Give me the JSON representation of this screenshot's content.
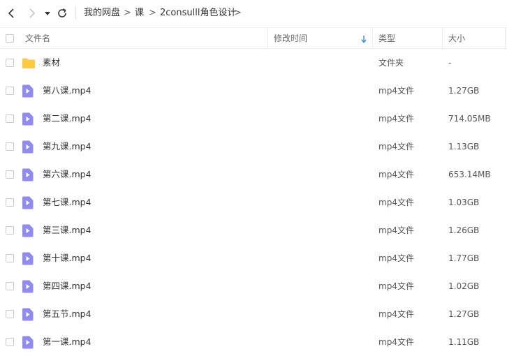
{
  "breadcrumb": {
    "items": [
      "我的网盘",
      "课",
      "2consulll角色设计"
    ],
    "separator": ">"
  },
  "header": {
    "name": "文件名",
    "modified": "修改时间",
    "type": "类型",
    "size": "大小",
    "sort_column": "modified",
    "sort_direction": "descending"
  },
  "files": [
    {
      "name": "素材",
      "type": "文件夹",
      "size": "-",
      "icon": "folder-icon"
    },
    {
      "name": "第八课.mp4",
      "type": "mp4文件",
      "size": "1.27GB",
      "icon": "video-file-icon"
    },
    {
      "name": "第二课.mp4",
      "type": "mp4文件",
      "size": "714.05MB",
      "icon": "video-file-icon"
    },
    {
      "name": "第九课.mp4",
      "type": "mp4文件",
      "size": "1.13GB",
      "icon": "video-file-icon"
    },
    {
      "name": "第六课.mp4",
      "type": "mp4文件",
      "size": "653.14MB",
      "icon": "video-file-icon"
    },
    {
      "name": "第七课.mp4",
      "type": "mp4文件",
      "size": "1.03GB",
      "icon": "video-file-icon"
    },
    {
      "name": "第三课.mp4",
      "type": "mp4文件",
      "size": "1.26GB",
      "icon": "video-file-icon"
    },
    {
      "name": "第十课.mp4",
      "type": "mp4文件",
      "size": "1.77GB",
      "icon": "video-file-icon"
    },
    {
      "name": "第四课.mp4",
      "type": "mp4文件",
      "size": "1.02GB",
      "icon": "video-file-icon"
    },
    {
      "name": "第五节.mp4",
      "type": "mp4文件",
      "size": "1.27GB",
      "icon": "video-file-icon"
    },
    {
      "name": "第一课.mp4",
      "type": "mp4文件",
      "size": "1.11GB",
      "icon": "video-file-icon"
    }
  ],
  "colors": {
    "folder": "#FFC940",
    "video_icon": "#8F8BF0",
    "sort_arrow": "#2F8BF5"
  }
}
